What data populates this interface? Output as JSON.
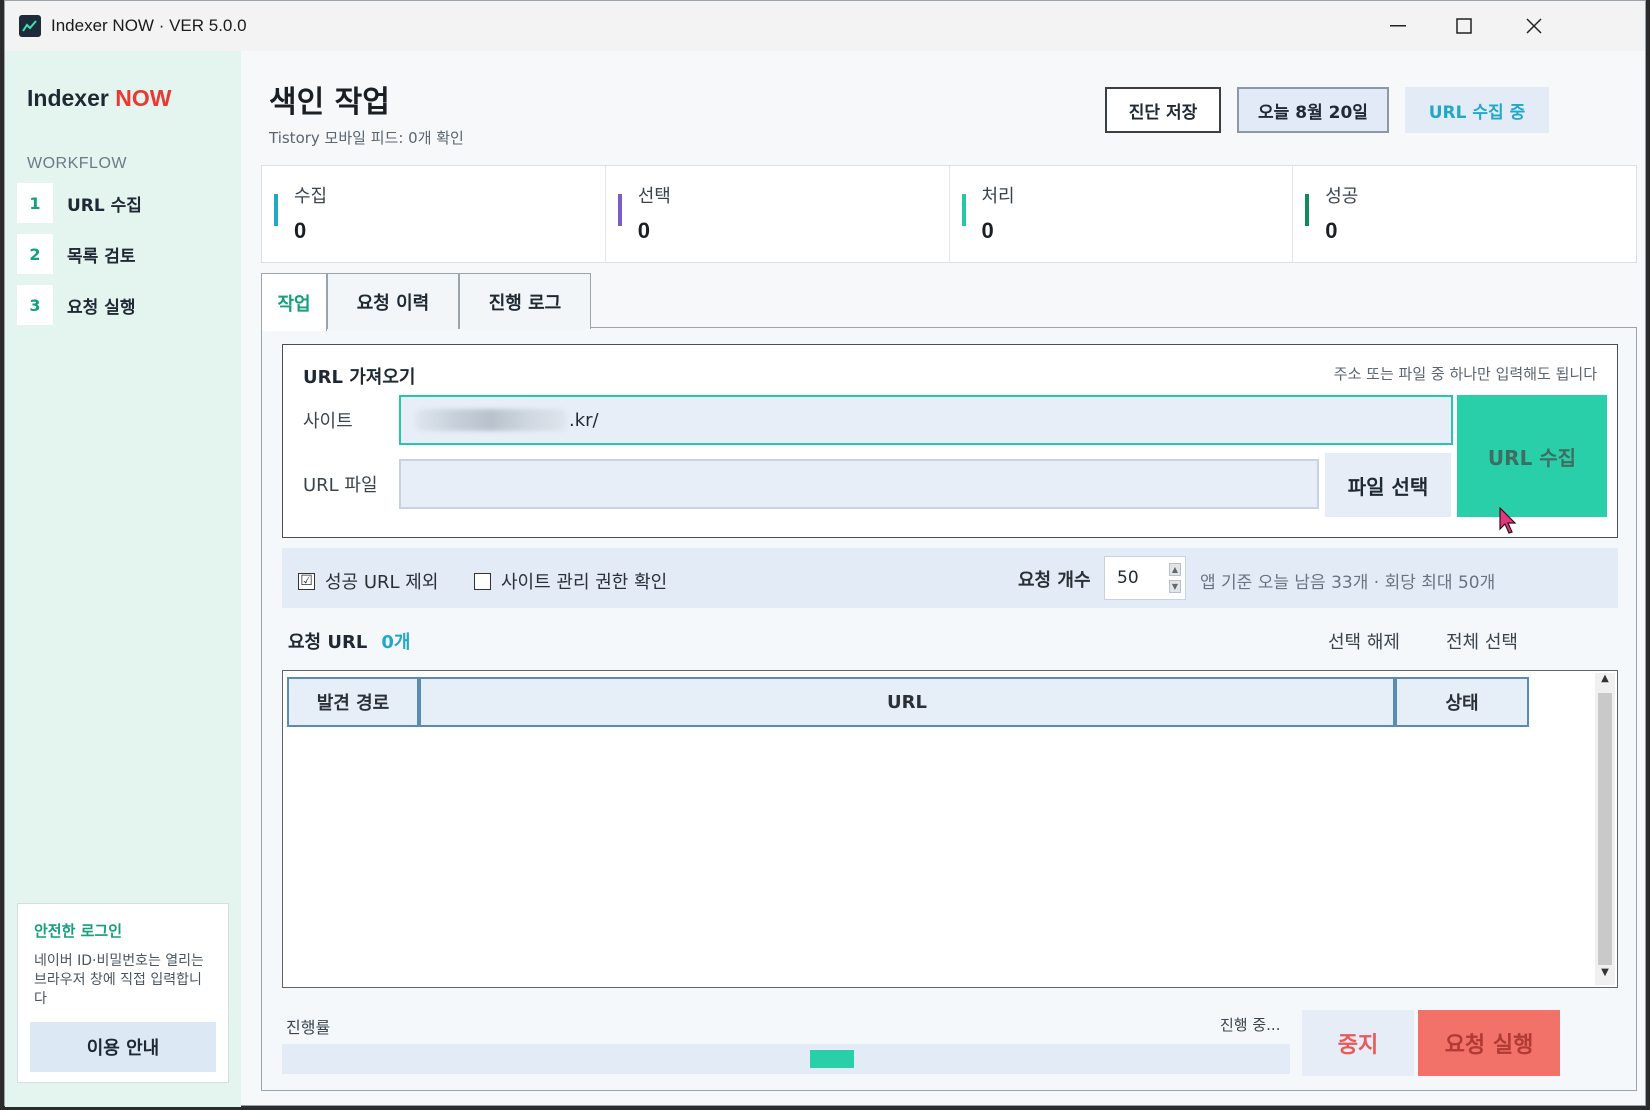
{
  "window": {
    "title": "Indexer NOW · VER 5.0.0",
    "controls": {
      "minimize": "—",
      "maximize": "☐",
      "close": "✕"
    }
  },
  "sidebar": {
    "brand_main": "Indexer",
    "brand_accent": "NOW",
    "workflow_label": "WORKFLOW",
    "items": [
      {
        "num": "1",
        "label": "URL 수집"
      },
      {
        "num": "2",
        "label": "목록 검토"
      },
      {
        "num": "3",
        "label": "요청 실행"
      }
    ],
    "login": {
      "title": "안전한 로그인",
      "desc": "네이버 ID·비밀번호는 열리는 브라우저 창에 직접 입력합니다",
      "guide_button": "이용 안내"
    }
  },
  "header": {
    "title": "색인 작업",
    "subtitle": "Tistory 모바일 피드: 0개 확인",
    "buttons": {
      "save_diag": "진단 저장",
      "today": "오늘 8월 20일",
      "status": "URL 수집 중"
    }
  },
  "stats": [
    {
      "label": "수집",
      "value": "0",
      "color": "#21a8c9"
    },
    {
      "label": "선택",
      "value": "0",
      "color": "#7b5cc9"
    },
    {
      "label": "처리",
      "value": "0",
      "color": "#26c6a6"
    },
    {
      "label": "성공",
      "value": "0",
      "color": "#138a5c"
    }
  ],
  "tabs": [
    "작업",
    "요청 이력",
    "진행 로그"
  ],
  "fetch": {
    "title": "URL 가져오기",
    "hint": "주소 또는 파일 중 하나만 입력해도 됩니다",
    "site_label": "사이트",
    "site_value": ".kr/",
    "file_label": "URL 파일",
    "file_value": "",
    "file_button": "파일 선택",
    "collect_button": "URL 수집"
  },
  "options": {
    "exclude_success": "성공 URL 제외",
    "exclude_success_checked": "☑",
    "check_admin": "사이트 관리 권한 확인",
    "request_count_label": "요청 개수",
    "request_count_value": "50",
    "quota_text": "앱 기준 오늘 남음 33개 · 회당 최대 50개"
  },
  "request_list": {
    "title": "요청 URL",
    "count": "0개",
    "deselect": "선택 해제",
    "select_all": "전체 선택",
    "columns": [
      "발견 경로",
      "URL",
      "상태"
    ],
    "rows": []
  },
  "progress": {
    "label": "진행률",
    "status": "진행 중...",
    "stop_button": "중지",
    "run_button": "요청 실행"
  },
  "colors": {
    "accent": "#26c6a6",
    "brand_red": "#e83a32",
    "danger": "#f2726a",
    "info": "#21a8c9"
  }
}
